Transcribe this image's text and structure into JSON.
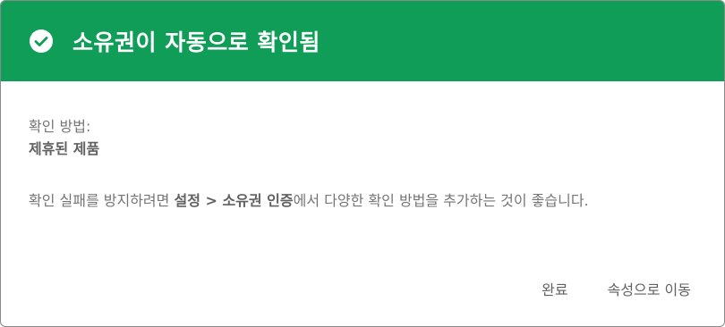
{
  "header": {
    "title": "소유권이 자동으로 확인됨",
    "icon": "check-circle-icon",
    "color": "#0f9d58"
  },
  "verification": {
    "method_label": "확인 방법:",
    "method_value": "제휴된 제품"
  },
  "advice": {
    "prefix": "확인 실패를 방지하려면 ",
    "link_text": "설정 > 소유권 인증",
    "suffix": "에서 다양한 확인 방법을 추가하는 것이 좋습니다."
  },
  "actions": {
    "done_label": "완료",
    "go_to_property_label": "속성으로 이동"
  }
}
